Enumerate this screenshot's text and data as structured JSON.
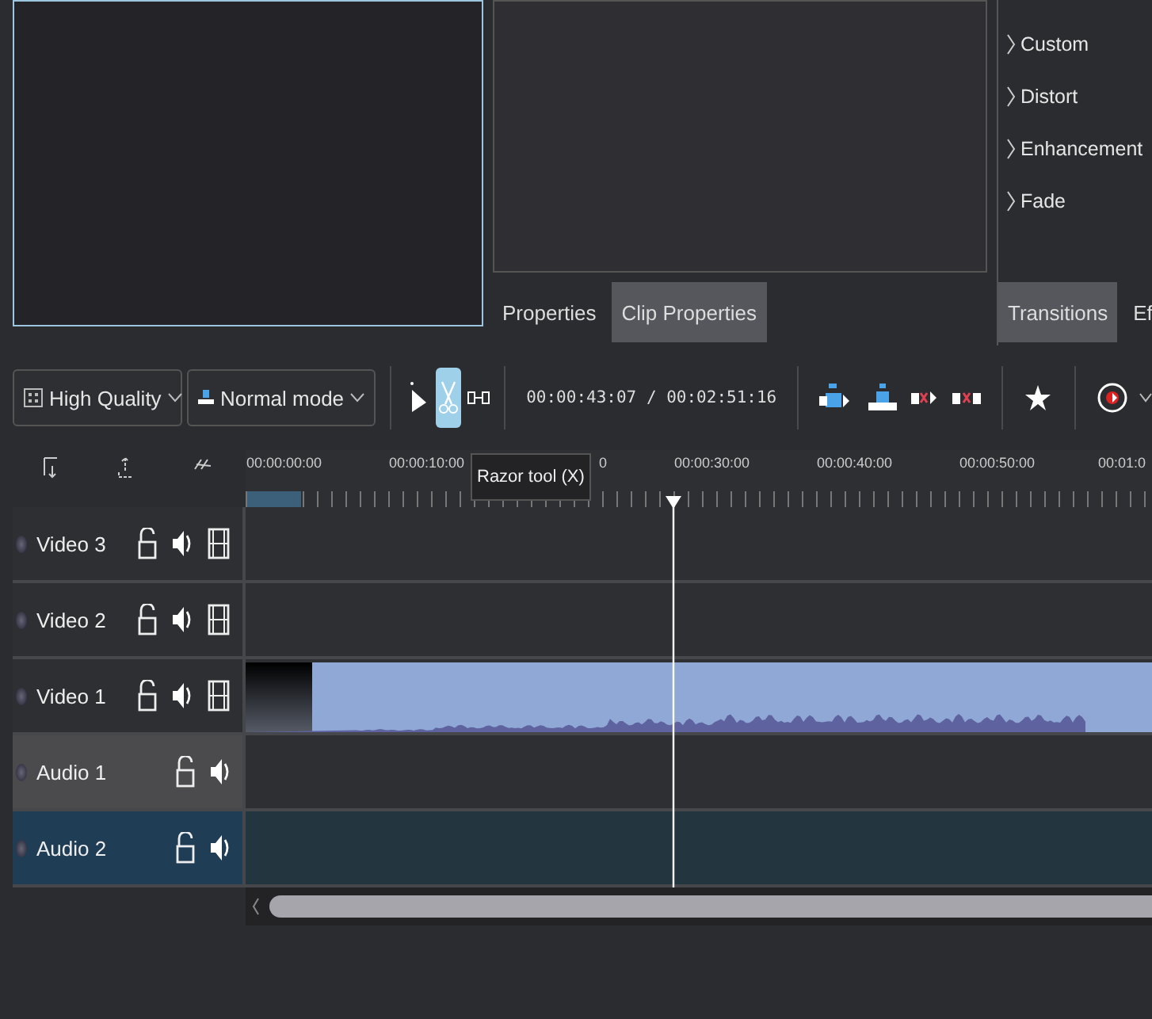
{
  "properties_panel": {
    "tabs": [
      {
        "label": "Properties",
        "selected": false
      },
      {
        "label": "Clip Properties",
        "selected": true
      }
    ]
  },
  "effects_panel": {
    "categories": [
      "Custom",
      "Distort",
      "Enhancement",
      "Fade"
    ],
    "tabs": [
      {
        "label": "Transitions",
        "selected": true
      },
      {
        "label": "Ef",
        "selected": false
      }
    ]
  },
  "toolbar": {
    "quality": "High Quality",
    "mode": "Normal mode",
    "tools": [
      {
        "kind": "select",
        "selected": false
      },
      {
        "kind": "razor",
        "selected": true
      },
      {
        "kind": "spacer",
        "selected": false
      }
    ],
    "timecode": "00:00:43:07 / 00:02:51:16",
    "tooltip": "Razor tool (X)"
  },
  "ruler": {
    "labels": [
      "00:00:00:00",
      "00:00:10:00",
      "0",
      "00:00:30:00",
      "00:00:40:00",
      "00:00:50:00",
      "00:01:0"
    ]
  },
  "tracks": [
    {
      "name": "Video 3",
      "kind": "video",
      "selected": false,
      "active": false
    },
    {
      "name": "Video 2",
      "kind": "video",
      "selected": false,
      "active": false
    },
    {
      "name": "Video 1",
      "kind": "video",
      "selected": false,
      "active": false
    },
    {
      "name": "Audio 1",
      "kind": "audio",
      "selected": false,
      "active": true
    },
    {
      "name": "Audio 2",
      "kind": "audio",
      "selected": true,
      "active": false
    }
  ]
}
